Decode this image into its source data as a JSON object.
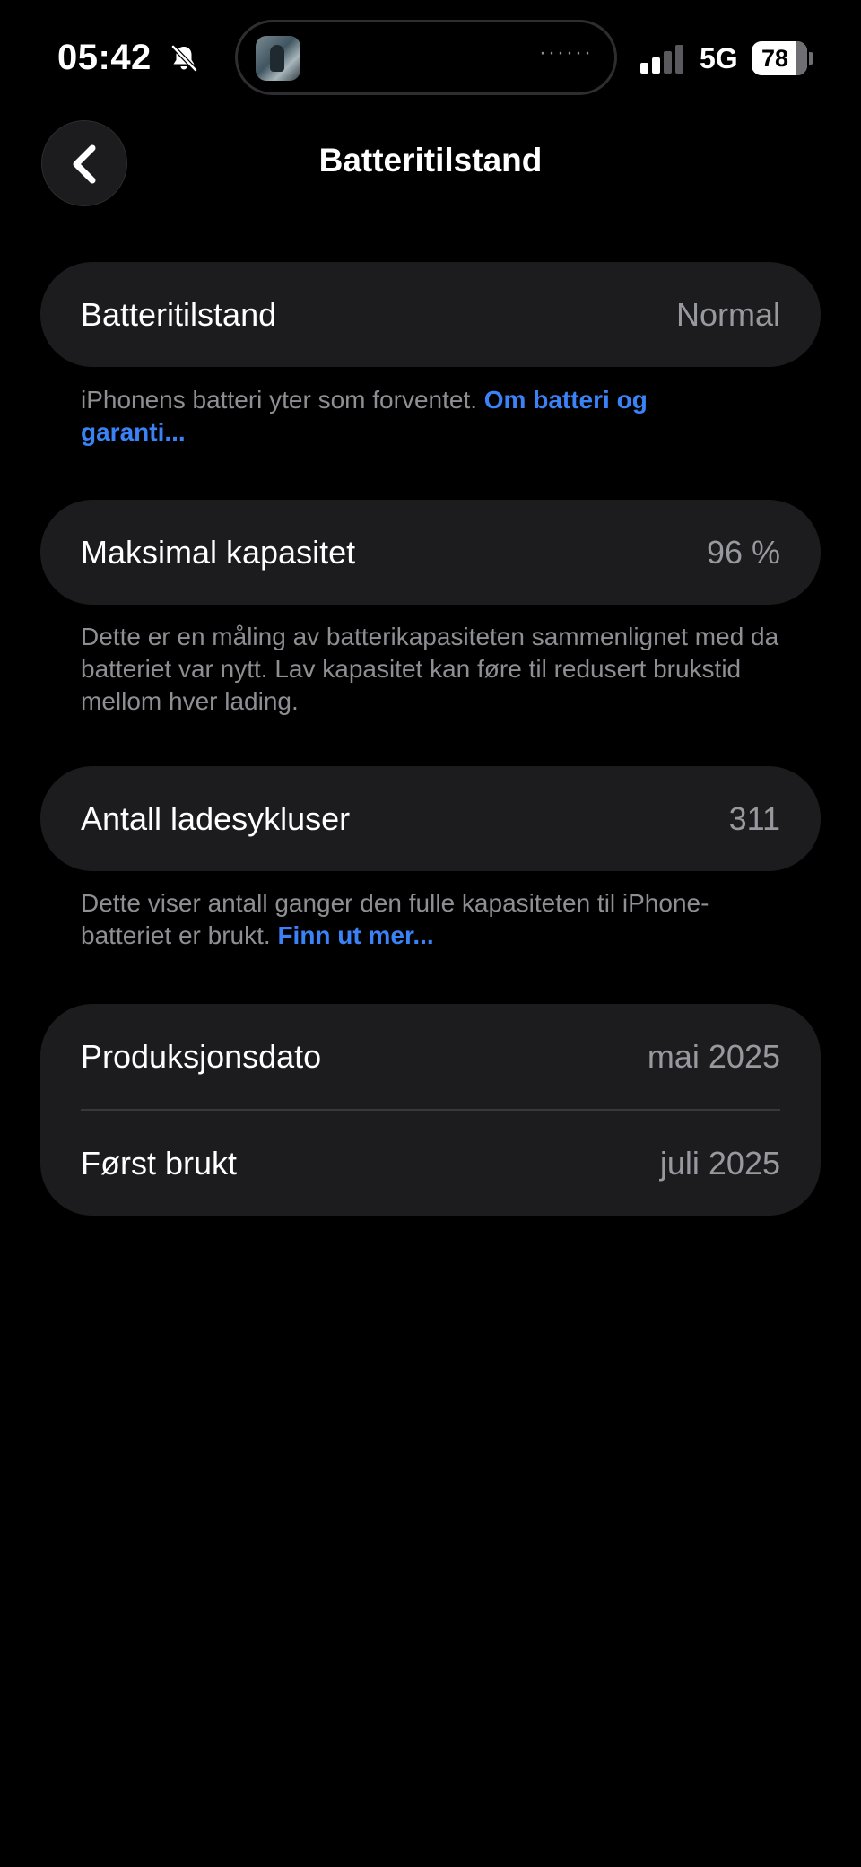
{
  "status_bar": {
    "time": "05:42",
    "network": "5G",
    "battery_level": "78",
    "icons": [
      "bell-slash-icon",
      "signal-bars-icon",
      "battery-icon"
    ]
  },
  "nav": {
    "title": "Batteritilstand",
    "back_icon": "chevron-left-icon"
  },
  "sections": {
    "health": {
      "label": "Batteritilstand",
      "value": "Normal",
      "footnote_text": "iPhonens batteri yter som forventet. ",
      "footnote_link": "Om batteri og garanti..."
    },
    "capacity": {
      "label": "Maksimal kapasitet",
      "value": "96 %",
      "footnote_text": "Dette er en måling av batterikapasiteten sammenlignet med da batteriet var nytt. Lav kapasitet kan føre til redusert brukstid mellom hver lading."
    },
    "cycles": {
      "label": "Antall ladesykluser",
      "value": "311",
      "footnote_text": "Dette viser antall ganger den fulle kapasiteten til iPhone-batteriet er brukt. ",
      "footnote_link": "Finn ut mer..."
    },
    "dates": {
      "production_label": "Produksjonsdato",
      "production_value": "mai 2025",
      "first_use_label": "Først brukt",
      "first_use_value": "juli 2025"
    }
  },
  "colors": {
    "background": "#000000",
    "card": "#1c1c1e",
    "secondary_text": "#8e8e93",
    "link": "#3b82f6"
  }
}
